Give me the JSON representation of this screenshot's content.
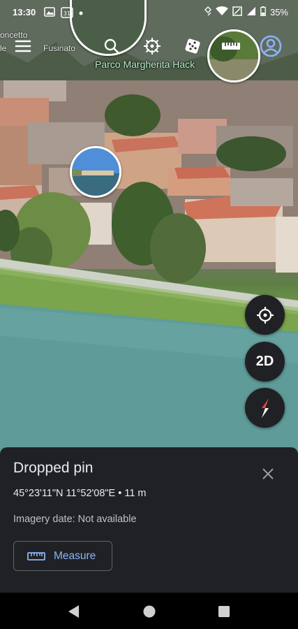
{
  "status_bar": {
    "time": "13:30",
    "battery": "35%",
    "calendar_day": "31",
    "left_icons": [
      "image-icon",
      "calendar-icon",
      "dot-icon"
    ],
    "right_icons": [
      "vibrate-icon",
      "wifi-icon",
      "alarm-icon",
      "signal-icon",
      "battery-icon"
    ]
  },
  "map": {
    "place_label": "Parco Margherita Hack",
    "background_labels": [
      "oncetto",
      "le",
      "Fusinato"
    ]
  },
  "toolbar": {
    "icons": [
      "menu-icon",
      "search-icon",
      "voyager-icon",
      "feeling-lucky-icon",
      "measure-icon",
      "account-icon"
    ]
  },
  "controls": {
    "locate_icon": "my-location-icon",
    "view_mode": "2D",
    "compass_icon": "compass-icon"
  },
  "sheet": {
    "title": "Dropped pin",
    "coordinates": "45°23'11\"N 11°52'08\"E • 11 m",
    "imagery_date": "Imagery date: Not available",
    "measure_label": "Measure",
    "close_icon": "close-icon"
  },
  "nav_bar": {
    "icons": [
      "back-icon",
      "home-icon",
      "recents-icon"
    ]
  },
  "colors": {
    "sheet_bg": "#202124",
    "accent": "#8ab4f8",
    "label_green": "#b9f0d0",
    "fab_bg": "#202124"
  }
}
